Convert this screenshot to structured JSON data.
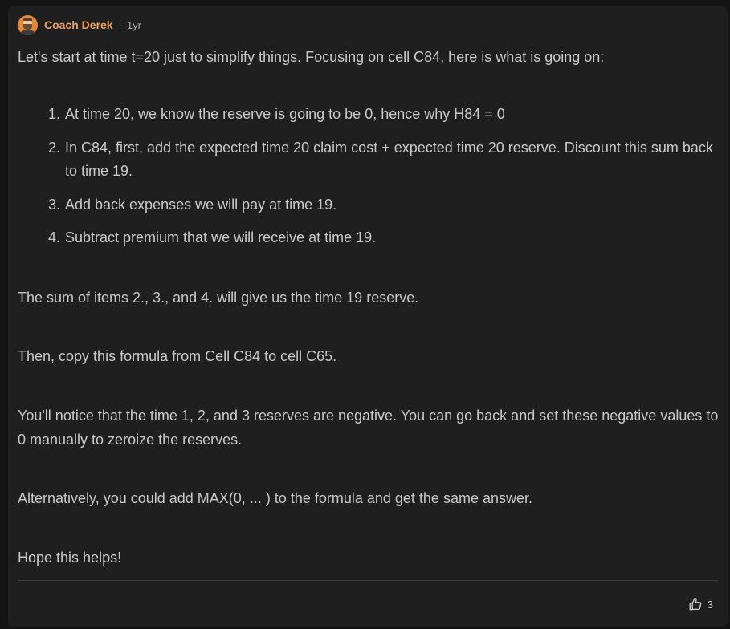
{
  "comment": {
    "author": "Coach Derek",
    "separator": "·",
    "age": "1yr",
    "intro": "Let's start at time t=20 just to simplify things. Focusing on cell C84, here is what is going on:",
    "steps": [
      {
        "num": "1.",
        "text": "At time 20, we know the reserve is going to be 0, hence why H84 = 0"
      },
      {
        "num": "2.",
        "text": "In C84, first, add the expected time 20 claim cost + expected time 20 reserve. Discount this sum back to time 19."
      },
      {
        "num": "3.",
        "text": "Add back expenses we will pay at time 19."
      },
      {
        "num": "4.",
        "text": "Subtract premium that we will receive at time 19."
      }
    ],
    "sum_note": "The sum of items 2., 3., and 4. will give us the time 19 reserve.",
    "copy_note": "Then, copy this formula from Cell C84 to cell C65.",
    "negative_note": "You'll notice that the time 1, 2, and 3 reserves are negative. You can go back and set these negative values to 0 manually to zeroize the reserves.",
    "alternative_note": "Alternatively, you could add MAX(0, ... ) to the formula and get the same answer.",
    "closing": "Hope this helps!",
    "likes": "3"
  },
  "icons": {
    "avatar": "user-avatar",
    "like": "thumbs-up-icon"
  },
  "colors": {
    "author": "#f0a060",
    "background": "#1f1f1f",
    "text": "#c9c9c9"
  }
}
